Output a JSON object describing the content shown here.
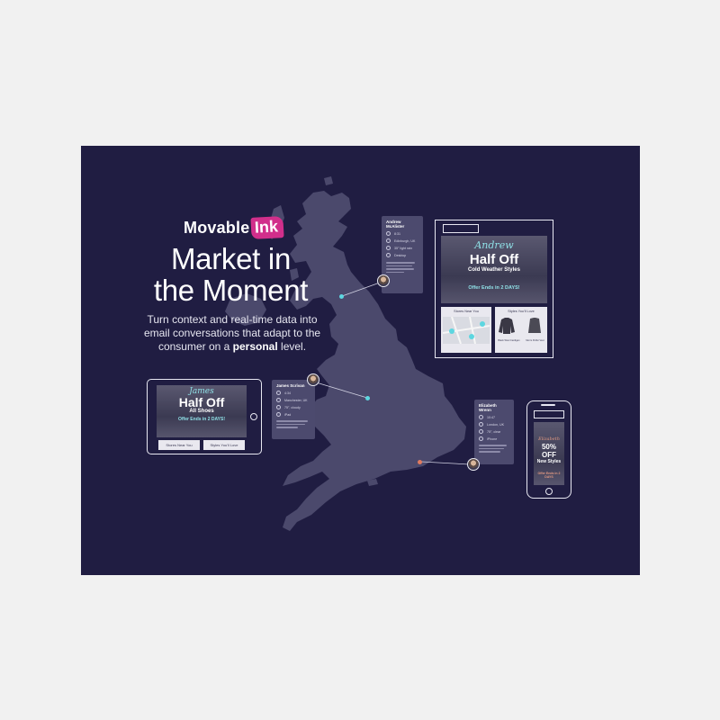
{
  "brand": {
    "name_part1": "Movable",
    "name_part2": "Ink",
    "accent": "#d12f8b"
  },
  "headline": {
    "line1": "Market in",
    "line2": "the Moment"
  },
  "subtext": {
    "line1": "Turn context and real-time data into",
    "line2": "email conversations that adapt to the",
    "line3_before": "consumer on a ",
    "line3_bold": "personal",
    "line3_after": " level."
  },
  "colors": {
    "panel": "#201d42",
    "map": "#4b496c",
    "cyan": "#5dd6e0",
    "orange": "#e07a5f"
  },
  "cards": {
    "andrew": {
      "name": "Andrew McAlister",
      "rows": [
        "8:31",
        "Edinburgh, UK",
        "35° light rain",
        "Desktop"
      ]
    },
    "james": {
      "name": "James Scrivan",
      "rows": [
        "4:34",
        "Manchester, UK",
        "75°, cloudy",
        "iPad"
      ]
    },
    "elizabeth": {
      "name": "Elizabeth Wrenn",
      "rows": [
        "10:47",
        "London, UK",
        "75°, clear",
        "iPhone"
      ]
    }
  },
  "desktop_email": {
    "name": "Andrew",
    "title": "Half Off",
    "subtitle": "Cold Weather Styles",
    "offer": "Offer Ends in 2 DAYS!",
    "stores": "Stores Near You",
    "styles": "Styles You'll Love",
    "item1": "Black Wool Cardigan",
    "item2": "Men's Puffer Vest"
  },
  "tablet_email": {
    "name": "James",
    "title": "Half Off",
    "subtitle": "All Shoes",
    "offer": "Offer Ends in 2 DAYS!",
    "btn1": "Stores Near You",
    "btn2": "Styles You'll Love"
  },
  "phone_email": {
    "name": "Elizabeth",
    "title": "50% OFF",
    "subtitle": "New Styles",
    "offer": "Offer Ends in 2 DAYS"
  }
}
